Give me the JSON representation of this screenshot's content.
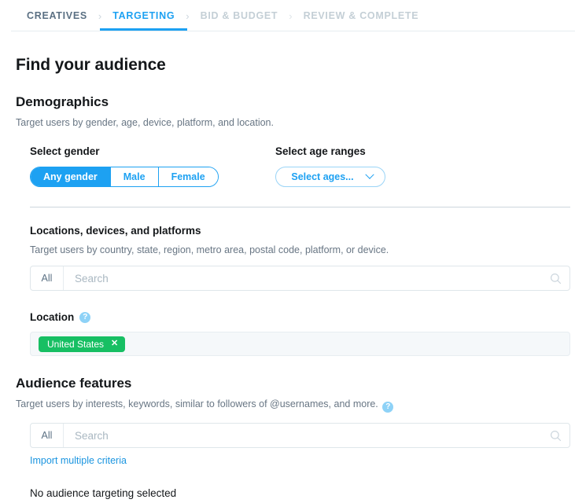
{
  "stepnav": {
    "steps": [
      {
        "label": "CREATIVES",
        "state": "done"
      },
      {
        "label": "TARGETING",
        "state": "active"
      },
      {
        "label": "BID & BUDGET",
        "state": "upcoming"
      },
      {
        "label": "REVIEW & COMPLETE",
        "state": "upcoming"
      }
    ],
    "separator": "›"
  },
  "page": {
    "title": "Find your audience"
  },
  "demographics": {
    "title": "Demographics",
    "description": "Target users by gender, age, device, platform, and location.",
    "gender": {
      "label": "Select gender",
      "options": [
        {
          "label": "Any gender",
          "selected": true
        },
        {
          "label": "Male",
          "selected": false
        },
        {
          "label": "Female",
          "selected": false
        }
      ]
    },
    "age": {
      "label": "Select age ranges",
      "value": "Select ages...",
      "chevron_icon": "chevron-down-icon"
    },
    "locations": {
      "title": "Locations, devices, and platforms",
      "description": "Target users by country, state, region, metro area, postal code, platform, or device.",
      "search": {
        "scope": "All",
        "placeholder": "Search",
        "value": "",
        "search_icon": "search-icon"
      }
    },
    "location": {
      "label": "Location",
      "help_icon": "help-icon",
      "chips": [
        {
          "label": "United States",
          "color": "#17bf63",
          "remove_icon": "close-icon",
          "remove_label": "✕"
        }
      ]
    }
  },
  "audience_features": {
    "title": "Audience features",
    "description": "Target users by interests, keywords, similar to followers of @usernames, and more.",
    "help_icon": "help-icon",
    "search": {
      "scope": "All",
      "placeholder": "Search",
      "value": "",
      "search_icon": "search-icon"
    },
    "import_link": "Import multiple criteria",
    "empty_state": "No audience targeting selected"
  },
  "colors": {
    "accent_blue": "#1da1f2",
    "link_blue": "#1b95e0",
    "chip_green": "#17bf63",
    "muted_text": "#687684",
    "disabled_text": "#c4cfd6",
    "divider": "#ccd6dd",
    "help_blue": "#8ed2f7"
  }
}
